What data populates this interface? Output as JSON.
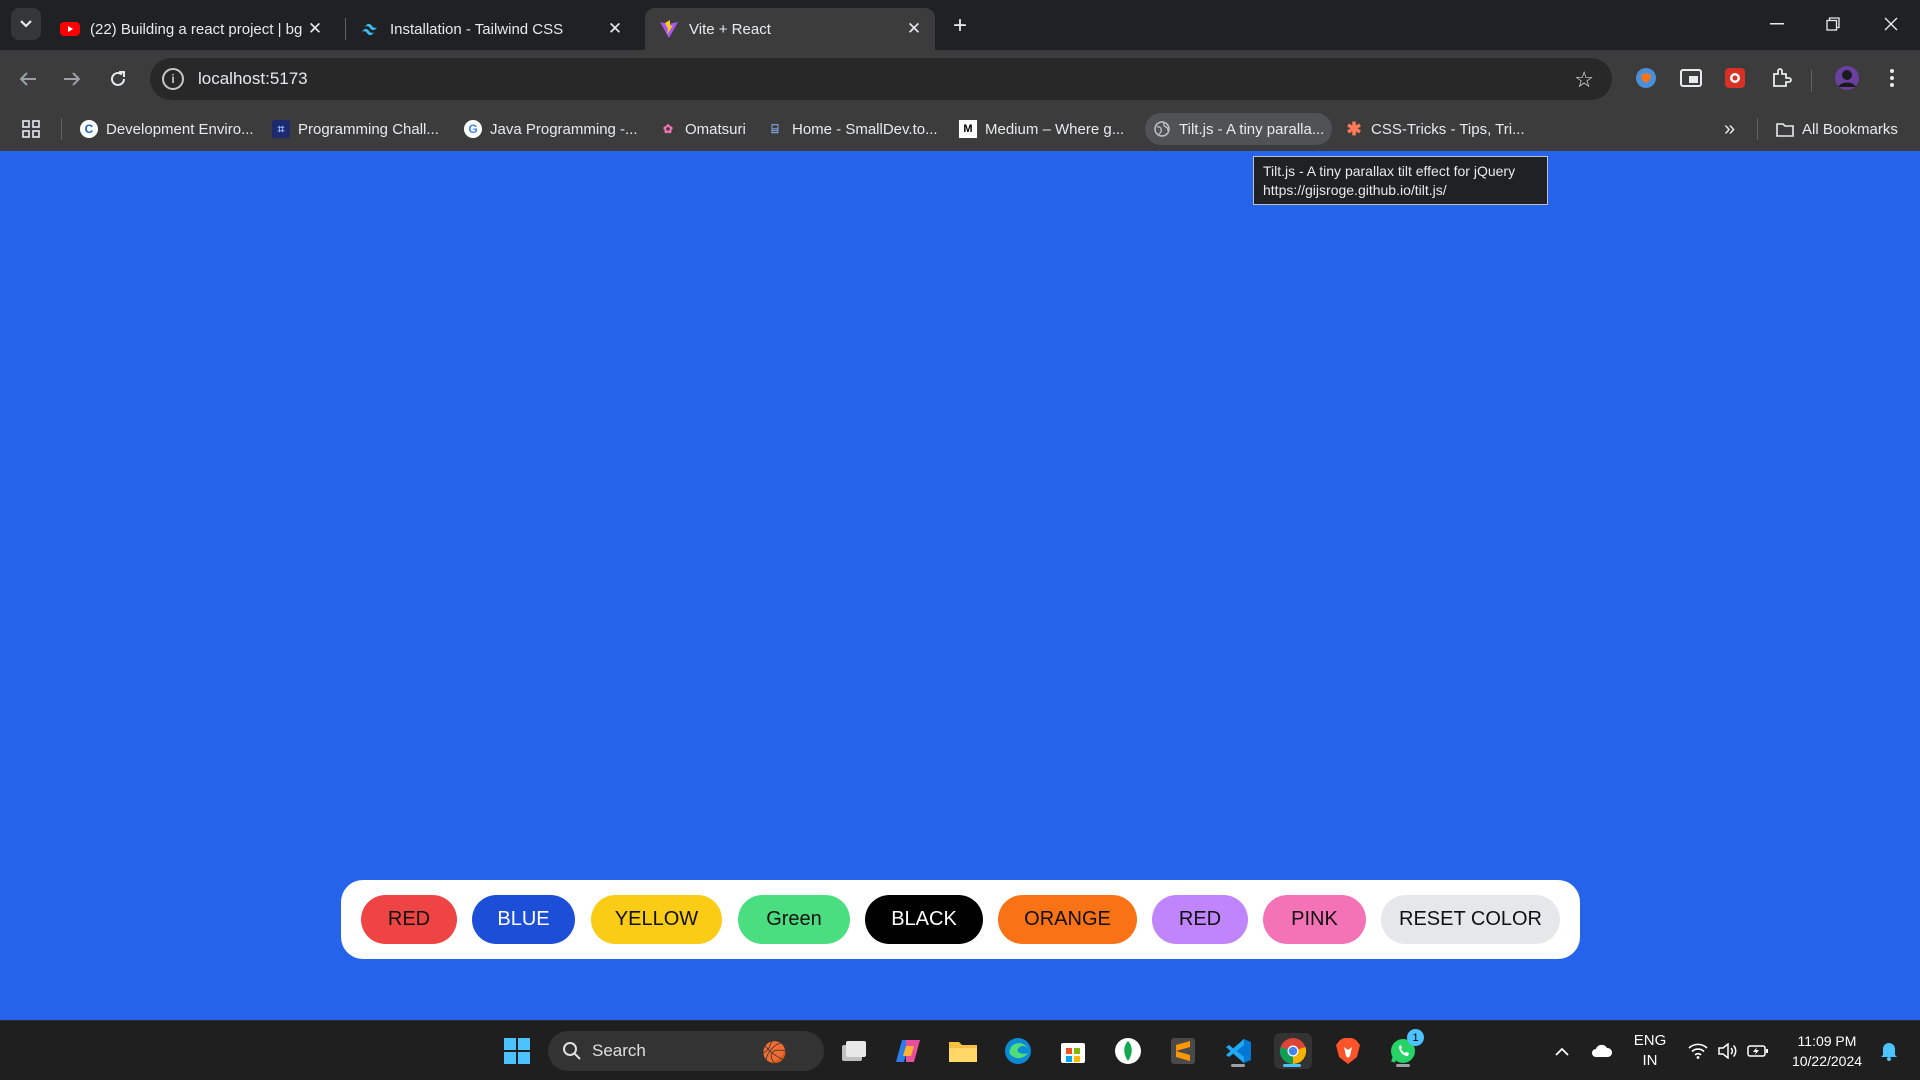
{
  "tabs": [
    {
      "title": "(22) Building a react project | bg",
      "favicon": "youtube-icon",
      "active": false
    },
    {
      "title": "Installation - Tailwind CSS",
      "favicon": "tailwind-icon",
      "active": false
    },
    {
      "title": "Vite + React",
      "favicon": "vite-icon",
      "active": true
    }
  ],
  "toolbar": {
    "url": "localhost:5173"
  },
  "bookmarks": [
    {
      "label": "Development Enviro...",
      "icon": "c-logo-icon"
    },
    {
      "label": "Programming Chall...",
      "icon": "code-icon"
    },
    {
      "label": "Java Programming -...",
      "icon": "google-icon"
    },
    {
      "label": "Omatsuri",
      "icon": "omatsuri-icon"
    },
    {
      "label": "Home - SmallDev.to...",
      "icon": "smalldev-icon"
    },
    {
      "label": "Medium – Where g...",
      "icon": "medium-icon"
    },
    {
      "label": "Tilt.js - A tiny paralla...",
      "icon": "globe-icon"
    },
    {
      "label": "CSS-Tricks - Tips, Tri...",
      "icon": "css-tricks-icon"
    }
  ],
  "all_bookmarks_label": "All Bookmarks",
  "tooltip": {
    "line1": "Tilt.js - A tiny parallax tilt effect for jQuery",
    "line2": "https://gijsroge.github.io/tilt.js/"
  },
  "page": {
    "background_color": "#2563eb",
    "buttons": [
      {
        "label": "RED",
        "bg": "#ef4444",
        "fg": "#111111"
      },
      {
        "label": "BLUE",
        "bg": "#1d4ed8",
        "fg": "#ffffff"
      },
      {
        "label": "YELLOW",
        "bg": "#facc15",
        "fg": "#111111"
      },
      {
        "label": "Green",
        "bg": "#4ade80",
        "fg": "#111111"
      },
      {
        "label": "BLACK",
        "bg": "#000000",
        "fg": "#ffffff"
      },
      {
        "label": "ORANGE",
        "bg": "#f97316",
        "fg": "#111111"
      },
      {
        "label": "RED",
        "bg": "#c084fc",
        "fg": "#111111"
      },
      {
        "label": "PINK",
        "bg": "#f472b6",
        "fg": "#111111"
      },
      {
        "label": "RESET COLOR",
        "bg": "#e5e7eb",
        "fg": "#111111"
      }
    ]
  },
  "taskbar": {
    "search_label": "Search",
    "language_line1": "ENG",
    "language_line2": "IN",
    "time": "11:09 PM",
    "date": "10/22/2024",
    "whatsapp_badge": "1"
  }
}
